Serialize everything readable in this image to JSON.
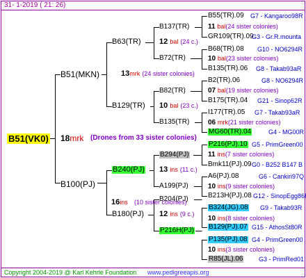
{
  "header": {
    "date": "31-   1-2019 (  21:  26)"
  },
  "footer": {
    "copyright": "Copyright 2004-2019 @ Karl Kehrle Foundation",
    "url": "www.pedigreeapis.org"
  },
  "colors": {
    "frame": "#9000a0",
    "lines": "#000000",
    "root_bg": "#ffff00",
    "green_hl": "#33ff33",
    "grey_hl": "#c0c0c0",
    "cyan_hl": "#33ccff",
    "info_text": "#0000c0",
    "mark_red": "#cc0000",
    "note_purple": "#8000c0"
  },
  "root": {
    "name": "B51(VK0)",
    "count": "18",
    "mark": "mrk",
    "note": "(Drones from 33 sister colonies)"
  },
  "gen1": {
    "p1": {
      "name": "B51(MKN)",
      "count": "13",
      "mark": "mrk",
      "note": "(24 sister colonies)"
    },
    "p2": {
      "name": "B100(PJ)",
      "count": "16",
      "mark": "ins",
      "note": "(10 sister colonies)"
    }
  },
  "gen2": {
    "a": {
      "name": "B63(TR)",
      "count": "12",
      "mark": "bal",
      "note": "(24 c.)"
    },
    "b": {
      "name": "B129(TR)",
      "count": "10",
      "mark": "bal",
      "note": "(23 c.)"
    },
    "c": {
      "name": "B240(PJ)",
      "count": "13",
      "mark": "ins",
      "note": "(11 c.)"
    },
    "d": {
      "name": "B180(PJ)",
      "count": "12",
      "mark": "ins",
      "note": "(9 c.)"
    }
  },
  "gen3": {
    "a": {
      "name": "B137(TR)",
      "count": "11",
      "mark": "bal",
      "note": "(24 sister colonies)"
    },
    "b": {
      "name": "B72(TR)",
      "count": "10",
      "mark": "bal",
      "note": "(23 sister colonies)"
    },
    "c": {
      "name": "B82(TR)",
      "count": "07",
      "mark": "bal",
      "note": "(19 sister colonies)"
    },
    "d": {
      "name": "B135(TR)",
      "count": "06",
      "mark": "mrk",
      "note": "(21 sister colonies)"
    },
    "e": {
      "name": "B294(PJ)",
      "count": "11",
      "mark": "ins",
      "note": "(7 sister colonies)"
    },
    "f": {
      "name": "A199(PJ)",
      "count": "10",
      "mark": "ins",
      "note": "(9 sister colonies)"
    },
    "g": {
      "name": "B204(PJ)",
      "count": "10",
      "mark": "ins",
      "note": "(8 sister colonies)"
    },
    "h": {
      "name": "P216H(PJ)",
      "count": "10",
      "mark": "ins",
      "note": "(3 sister colonies)"
    }
  },
  "gen4": [
    {
      "name": "B55(TR).09",
      "info": "G7 - Kangaroo98R"
    },
    {
      "name": "GR109(TR).09",
      "info": "G3 - Gr.R.mounta"
    },
    {
      "name": "B68(TR).08",
      "info": "G10 - NO6294R"
    },
    {
      "name": "B135(TR).06",
      "info": "G8 - Takab93aR"
    },
    {
      "name": "B2(TR).06",
      "info": "G8 - NO6294R"
    },
    {
      "name": "B175(TR).04",
      "info": "G21 - Sinop62R"
    },
    {
      "name": "I177(TR).05",
      "info": "G7 - Takab93aR"
    },
    {
      "name": "MG60(TR).04",
      "info": "G4 - MG00R"
    },
    {
      "name": "P216(PJ).10",
      "info": "G5 - PrimGreen00"
    },
    {
      "name": "Bmk11(PJ).09",
      "info": "G0 - B252 B147 B"
    },
    {
      "name": "A6(PJ).08",
      "info": "G6 - Cankiri97Q"
    },
    {
      "name": "B213H(PJ).08",
      "info": "G12 - SinopEgg86R"
    },
    {
      "name": "B324(JG).08",
      "info": "G9 - Takab93R"
    },
    {
      "name": "B129(PJ).07",
      "info": "G15 - AthosSt80R"
    },
    {
      "name": "P135(PJ).08",
      "info": "G4 - PrimGreen00"
    },
    {
      "name": "R85(JL).06",
      "info": "G3 - PrimRed01"
    }
  ]
}
